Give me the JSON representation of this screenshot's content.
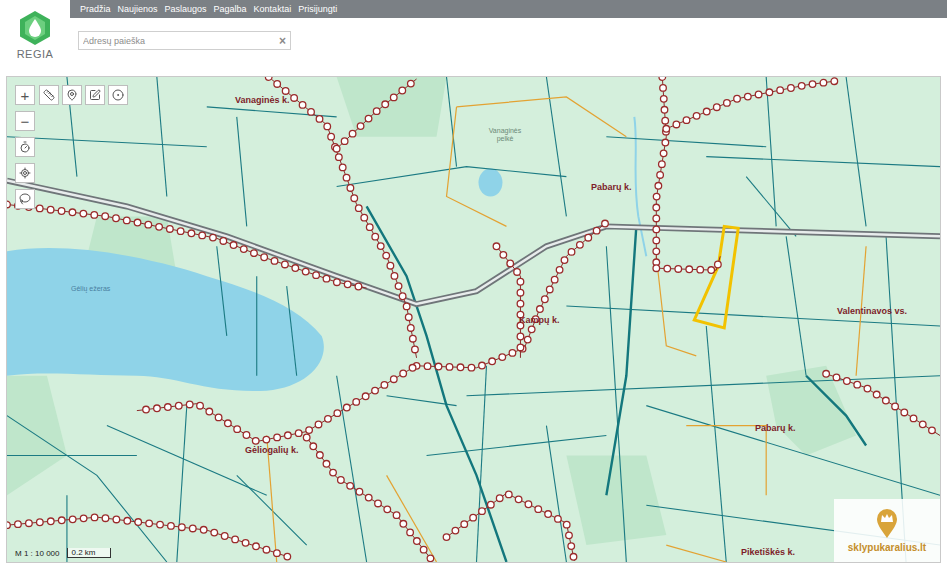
{
  "app": {
    "name": "REGIA"
  },
  "nav": [
    {
      "label": "Pradžia"
    },
    {
      "label": "Naujienos"
    },
    {
      "label": "Paslaugos"
    },
    {
      "label": "Pagalba"
    },
    {
      "label": "Kontaktai"
    },
    {
      "label": "Prisijungti"
    }
  ],
  "search": {
    "placeholder": "Adresų paieška",
    "clear": "×"
  },
  "zoom": {
    "in": "+",
    "out": "−"
  },
  "map": {
    "labels": [
      {
        "text": "Vanaginės k.",
        "kind": "village"
      },
      {
        "text": "Pabarų k.",
        "kind": "village"
      },
      {
        "text": "Kampų k.",
        "kind": "village"
      },
      {
        "text": "Valentinavos vs.",
        "kind": "village"
      },
      {
        "text": "Pabarų k.",
        "kind": "village"
      },
      {
        "text": "Gėliogalių k.",
        "kind": "village"
      },
      {
        "text": "Piketiškės k.",
        "kind": "village"
      },
      {
        "text": "Gėlių ežeras",
        "kind": "water"
      },
      {
        "text": "Vanaginės pelkė",
        "kind": "marsh"
      }
    ]
  },
  "scale": {
    "ratio": "M 1 : 10 000",
    "bar": "0.2 km"
  },
  "watermark": {
    "text": "sklypukaralius.lt"
  }
}
